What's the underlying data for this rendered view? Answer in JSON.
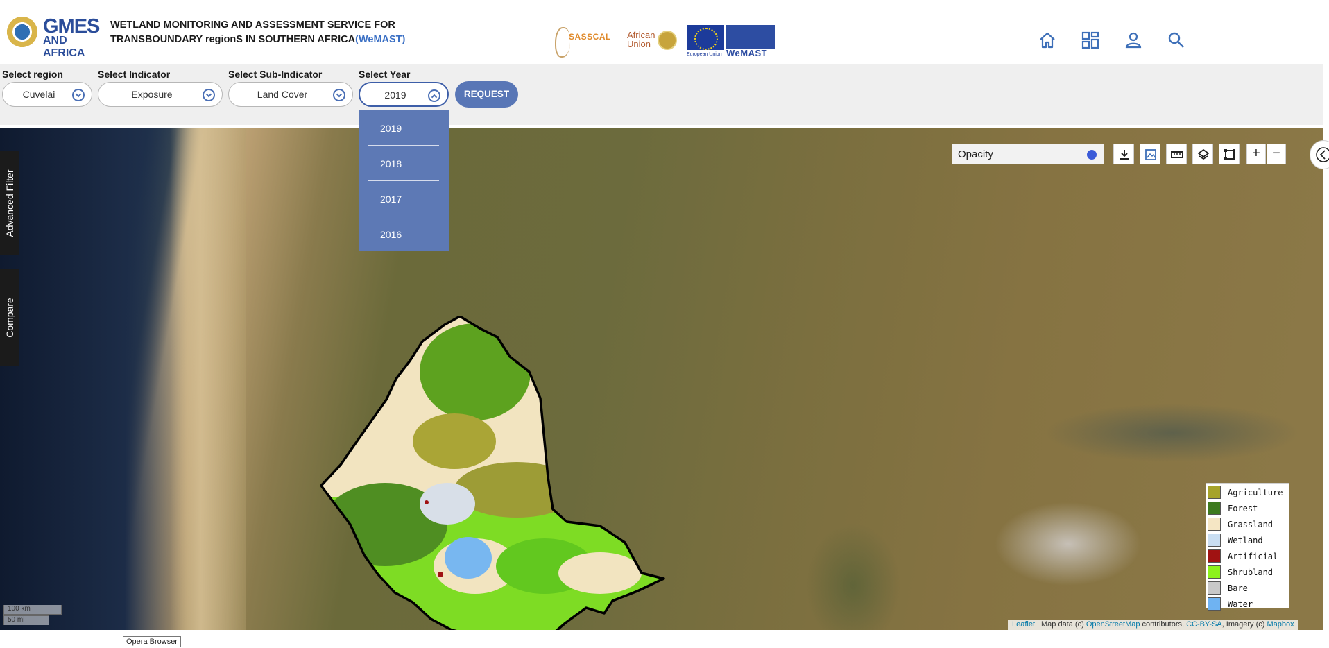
{
  "header": {
    "logo_top": "GMES",
    "logo_bottom": "AND AFRICA",
    "title_line1": "WETLAND MONITORING AND ASSESSMENT SERVICE FOR",
    "title_line2": "TRANSBOUNDARY regionS IN SOUTHERN AFRICA",
    "title_highlight": "(WeMAST)",
    "partners": {
      "sasscal": "SASSCAL",
      "african_union_line1": "African",
      "african_union_line2": "Union",
      "eu_label": "European Union",
      "wemast": "WeMAST"
    },
    "nav_icons": [
      "home-icon",
      "dashboard-icon",
      "user-icon",
      "search-icon"
    ]
  },
  "filters": {
    "region": {
      "label": "Select region",
      "value": "Cuvelai"
    },
    "indicator": {
      "label": "Select Indicator",
      "value": "Exposure"
    },
    "sub_indicator": {
      "label": "Select Sub-Indicator",
      "value": "Land Cover"
    },
    "year": {
      "label": "Select Year",
      "value": "2019",
      "options": [
        "2019",
        "2018",
        "2017",
        "2016"
      ]
    },
    "request_label": "REQUEST"
  },
  "side_tabs": [
    "Advanced Filter",
    "Compare"
  ],
  "map": {
    "opacity_label": "Opacity",
    "zoom_in": "+",
    "zoom_out": "−",
    "scale_km": "100 km",
    "scale_mi": "50 mi",
    "attribution": {
      "leaflet": "Leaflet",
      "sep1": " | Map data (c) ",
      "osm": "OpenStreetMap",
      "sep2": " contributors, ",
      "license": "CC-BY-SA",
      "sep3": ", Imagery (c) ",
      "mapbox": "Mapbox"
    }
  },
  "legend": [
    {
      "label": "Agriculture",
      "color": "#a6a32a"
    },
    {
      "label": "Forest",
      "color": "#3d7a1e"
    },
    {
      "label": "Grassland",
      "color": "#f5e6c4"
    },
    {
      "label": "Wetland",
      "color": "#c9def2"
    },
    {
      "label": "Artificial",
      "color": "#a01212"
    },
    {
      "label": "Shrubland",
      "color": "#8cf21b"
    },
    {
      "label": "Bare",
      "color": "#c8c8c8"
    },
    {
      "label": "Water",
      "color": "#6fb3f2"
    }
  ],
  "tooltip": "Opera Browser"
}
